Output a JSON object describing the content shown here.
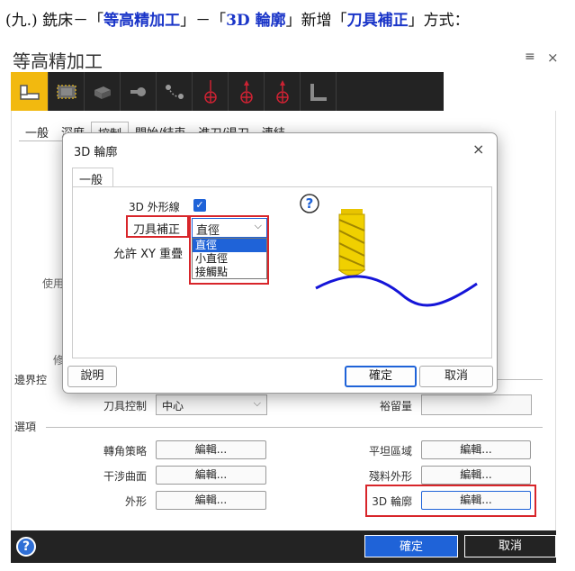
{
  "heading": {
    "prefix": "(九.) 銑床－「",
    "kw1": "等高精加工",
    "mid1": "」－「",
    "kw2": "3D 輪廓",
    "mid2": "」新增「",
    "kw3": "刀具補正",
    "suffix": "」方式："
  },
  "app": {
    "title": "等高精加工",
    "menu_icon": "≡",
    "close_icon": "×"
  },
  "toolbar": {
    "icons": [
      "toolpath-type-icon",
      "tool-icon",
      "stock-icon",
      "holder-icon",
      "parameters-icon",
      "axis-control-icon",
      "plane-icon",
      "planes-icon",
      "coolant-icon"
    ]
  },
  "tabs": [
    "一般",
    "深度",
    "控制",
    "開始/結束",
    "進刀/退刀",
    "連結"
  ],
  "main": {
    "side_label_use": "使用",
    "side_label_edit": "修",
    "boundary_section": "邊界控",
    "tool_control_label": "刀具控制",
    "tool_control_value": "中心",
    "stock_allowance_label": "裕留量",
    "options_section": "選項",
    "corner_label": "轉角策略",
    "interference_label": "干涉曲面",
    "outline_label": "外形",
    "flat_label": "平坦區域",
    "remaining_label": "殘料外形",
    "contour_label": "3D 輪廓",
    "edit_label": "編輯..."
  },
  "dialog": {
    "title": "3D 輪廓",
    "close_icon": "×",
    "tab": "一般",
    "outline_label": "3D 外形線",
    "tool_comp_label": "刀具補正",
    "tool_comp_value": "直徑",
    "overlap_label": "允許 XY 重疊",
    "options": [
      "直徑",
      "小直徑",
      "接觸點"
    ],
    "help_button": "說明",
    "ok_button": "確定",
    "cancel_button": "取消"
  },
  "footer": {
    "ok": "確定",
    "cancel": "取消",
    "help_icon": "?"
  },
  "colors": {
    "keyword": "#1a35c8",
    "highlight": "#d8252a",
    "accent": "#1f63d8",
    "toolbar_active": "#f2b90f",
    "toolbar_bg": "#232323"
  }
}
